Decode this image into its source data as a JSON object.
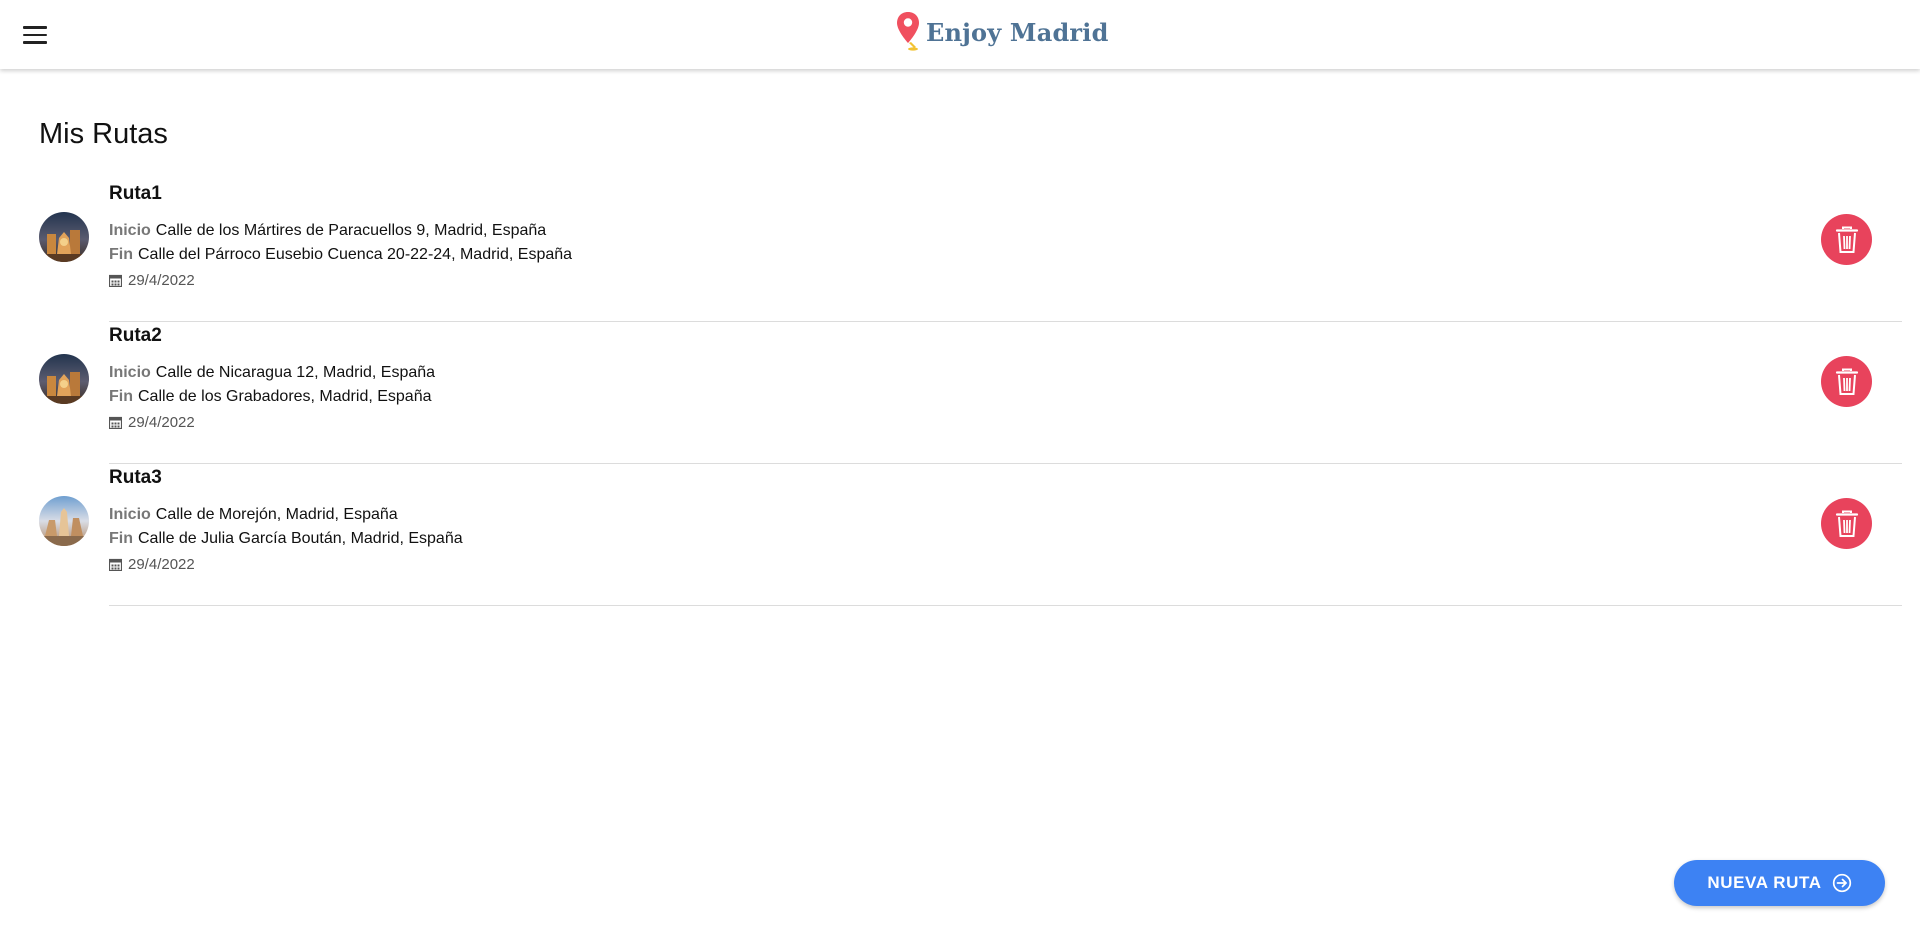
{
  "header": {
    "menu_icon": "hamburger-menu-icon",
    "logo_icon": "map-pin-icon",
    "brand": "Enjoy Madrid",
    "brand_color": "#4f7395",
    "pin_color": "#f0505f"
  },
  "page": {
    "title": "Mis Rutas"
  },
  "labels": {
    "start": "Inicio",
    "end": "Fin"
  },
  "routes": [
    {
      "name": "Ruta1",
      "start": "Calle de los Mártires de Paracuellos 9, Madrid, España",
      "end": "Calle del Párroco Eusebio Cuenca 20-22-24, Madrid, España",
      "date": "29/4/2022"
    },
    {
      "name": "Ruta2",
      "start": "Calle de Nicaragua 12, Madrid, España",
      "end": "Calle de los Grabadores, Madrid, España",
      "date": "29/4/2022"
    },
    {
      "name": "Ruta3",
      "start": "Calle de Morejón, Madrid, España",
      "end": "Calle de Julia García Boután, Madrid, España",
      "date": "29/4/2022"
    }
  ],
  "actions": {
    "new_route": "NUEVA RUTA",
    "new_route_icon": "arrow-right-circle-icon",
    "delete_icon": "trash-icon",
    "date_icon": "calendar-icon"
  },
  "colors": {
    "delete": "#e8435c",
    "primary": "#3d82f3"
  }
}
